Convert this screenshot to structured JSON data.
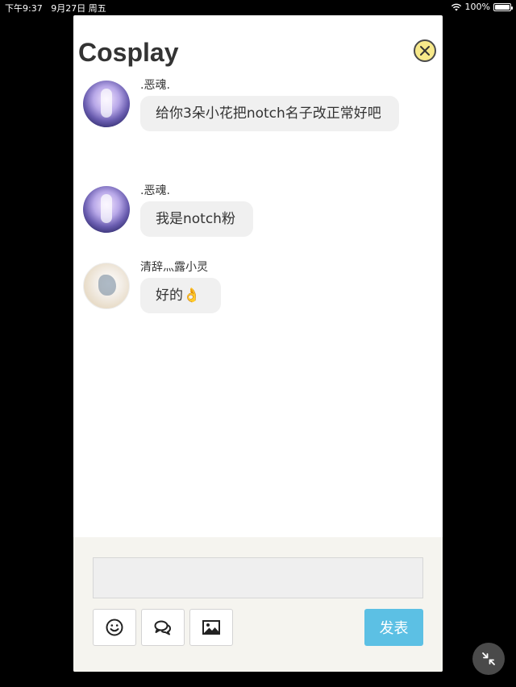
{
  "status_bar": {
    "time": "下午9:37",
    "date": "9月27日 周五",
    "battery_percent": "100%",
    "battery_level": 1.0
  },
  "header": {
    "title": "Cosplay",
    "close_icon": "close-circle-icon"
  },
  "messages": [
    {
      "name": ".恶魂.",
      "text": "给你3朵小花把notch名子改正常好吧",
      "avatar": "anime-avatar-blue"
    },
    {
      "name": ".恶魂.",
      "text": "我是notch粉",
      "avatar": "anime-avatar-blue"
    },
    {
      "name": "清辞灬露小灵",
      "text": "好的👌",
      "avatar": "anime-avatar-white"
    }
  ],
  "composer": {
    "input_value": "",
    "input_placeholder": "",
    "emoji_icon": "smiley-icon",
    "chat_icon": "speech-bubbles-icon",
    "image_icon": "image-icon",
    "send_label": "发表"
  },
  "colors": {
    "send_button": "#5cc0e4",
    "close_button": "#f7e98a",
    "bubble": "#f0f0f0",
    "footer": "#f5f4ef"
  },
  "floating": {
    "icon": "collapse-arrows-icon"
  }
}
